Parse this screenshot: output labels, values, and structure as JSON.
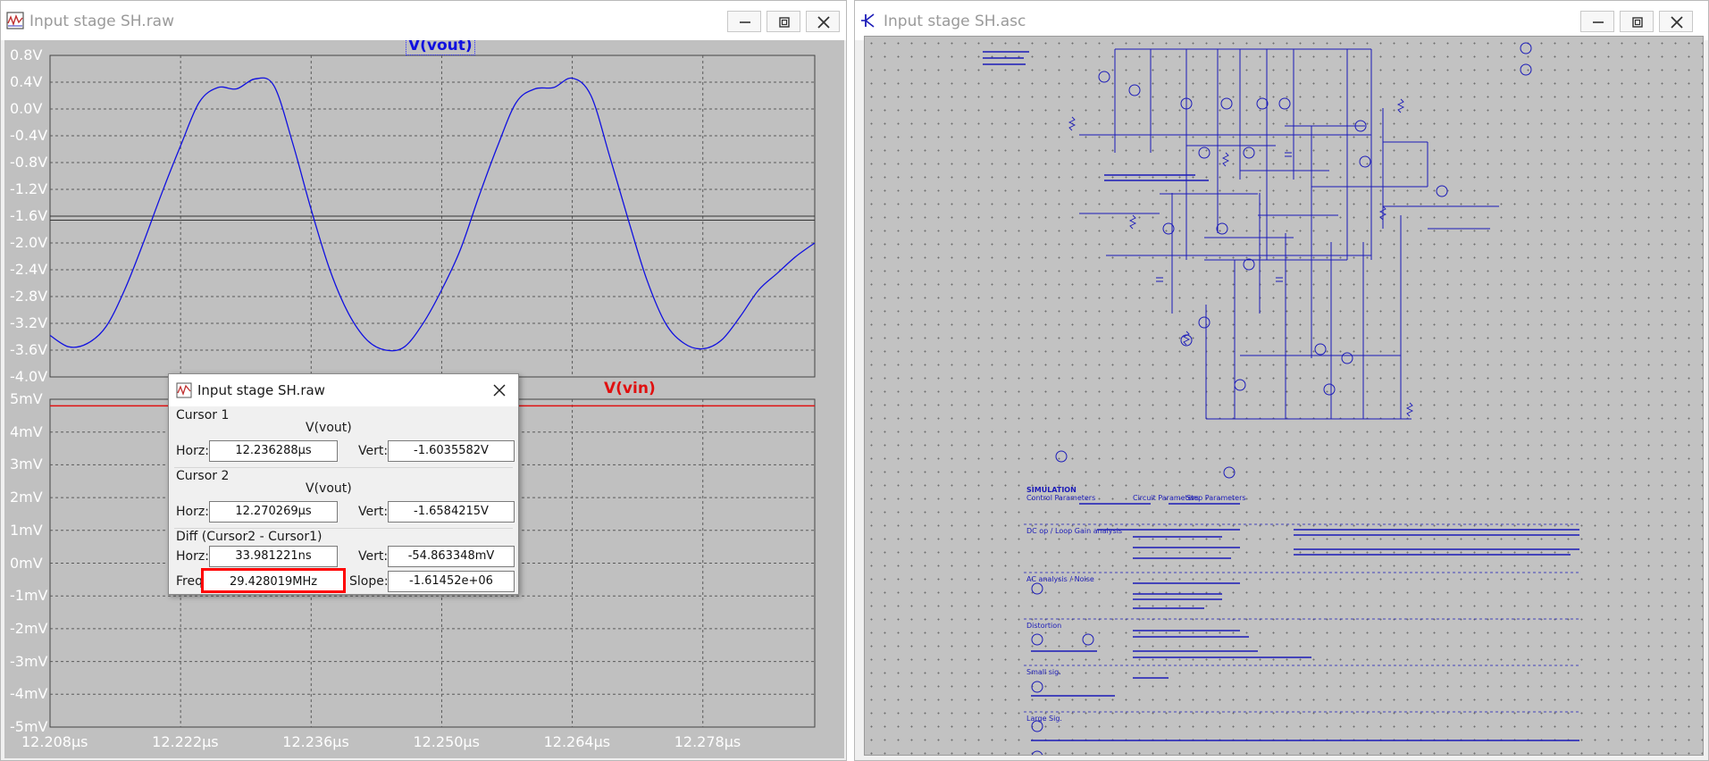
{
  "left_window": {
    "title": "Input stage SH.raw",
    "top_pane": {
      "trace": "V(vout)",
      "y_ticks": [
        "0.8V",
        "0.4V",
        "0.0V",
        "-0.4V",
        "-0.8V",
        "-1.2V",
        "-1.6V",
        "-2.0V",
        "-2.4V",
        "-2.8V",
        "-3.2V",
        "-3.6V",
        "-4.0V"
      ],
      "trace_color": "#1010e0"
    },
    "bottom_pane": {
      "trace": "V(vin)",
      "y_ticks": [
        "5mV",
        "4mV",
        "3mV",
        "2mV",
        "1mV",
        "0mV",
        "-1mV",
        "-2mV",
        "-3mV",
        "-4mV",
        "-5mV"
      ],
      "trace_color": "#e01010"
    },
    "x_ticks": [
      "12.208µs",
      "12.222µs",
      "12.236µs",
      "12.250µs",
      "12.264µs",
      "12.278µs"
    ]
  },
  "chart_data": [
    {
      "type": "line",
      "title": "",
      "series": [
        {
          "name": "V(vout)"
        }
      ],
      "x_unit": "µs",
      "xlim": [
        12.208,
        12.29
      ],
      "ylim": [
        -4.0,
        0.8
      ],
      "x": [
        12.208,
        12.21,
        12.212,
        12.214,
        12.216,
        12.218,
        12.22,
        12.222,
        12.224,
        12.226,
        12.228,
        12.23,
        12.232,
        12.234,
        12.236,
        12.238,
        12.24,
        12.242,
        12.244,
        12.246,
        12.248,
        12.25,
        12.252,
        12.254,
        12.256,
        12.258,
        12.26,
        12.262,
        12.264,
        12.266,
        12.268,
        12.27,
        12.272,
        12.274,
        12.276,
        12.278,
        12.28,
        12.282,
        12.284,
        12.286,
        12.288,
        12.29
      ],
      "y": [
        -3.38,
        -3.55,
        -3.5,
        -3.25,
        -2.7,
        -2.0,
        -1.25,
        -0.55,
        0.1,
        0.32,
        0.3,
        0.45,
        0.35,
        -0.5,
        -1.5,
        -2.4,
        -3.05,
        -3.45,
        -3.6,
        -3.55,
        -3.2,
        -2.7,
        -2.1,
        -1.3,
        -0.55,
        0.1,
        0.3,
        0.32,
        0.46,
        0.2,
        -0.7,
        -1.65,
        -2.55,
        -3.2,
        -3.5,
        -3.58,
        -3.45,
        -3.1,
        -2.7,
        -2.45,
        -2.2,
        -2.0
      ],
      "grid": true,
      "cursor_lines": [
        -1.6,
        -1.66
      ]
    },
    {
      "type": "line",
      "title": "",
      "series": [
        {
          "name": "V(vin)"
        }
      ],
      "x_unit": "µs",
      "xlim": [
        12.208,
        12.29
      ],
      "ylim": [
        -5,
        5
      ],
      "x": [
        12.208,
        12.29
      ],
      "y": [
        4.8,
        4.8
      ],
      "grid": true
    }
  ],
  "cursor_dialog": {
    "title": "Input stage SH.raw",
    "cursor1": {
      "heading": "Cursor 1",
      "trace": "V(vout)",
      "horz_label": "Horz:",
      "horz": "12.236288µs",
      "vert_label": "Vert:",
      "vert": "-1.6035582V"
    },
    "cursor2": {
      "heading": "Cursor 2",
      "trace": "V(vout)",
      "horz_label": "Horz:",
      "horz": "12.270269µs",
      "vert_label": "Vert:",
      "vert": "-1.6584215V"
    },
    "diff": {
      "heading": "Diff (Cursor2 - Cursor1)",
      "horz_label": "Horz:",
      "horz": "33.981221ns",
      "vert_label": "Vert:",
      "vert": "-54.863348mV",
      "freq_label": "Freq:",
      "freq": "29.428019MHz",
      "slope_label": "Slope:",
      "slope": "-1.61452e+06"
    },
    "highlight_color": "#ff0000"
  },
  "right_window": {
    "title": "Input stage SH.asc",
    "schematic_labels": {
      "simulation": "SIMULATION",
      "control": "Control Parameters",
      "circuit": "Circuit Parameters",
      "step": "Step Parameters",
      "dc_op": "DC op / Loop Gain analysis",
      "ac": "AC analysis / Noise",
      "distortion": "Distortion",
      "small_sig": "Small sig.",
      "large_sig": "Large Sig."
    },
    "wire_color": "#1b1bb8"
  }
}
